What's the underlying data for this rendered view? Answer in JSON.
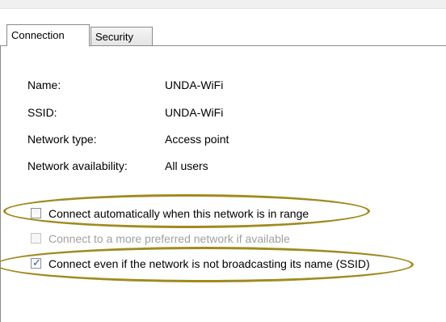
{
  "tabs": [
    {
      "label": "Connection"
    },
    {
      "label": "Security"
    }
  ],
  "info": {
    "name_label": "Name:",
    "name_value": "UNDA-WiFi",
    "ssid_label": "SSID:",
    "ssid_value": "UNDA-WiFi",
    "type_label": "Network type:",
    "type_value": "Access point",
    "availability_label": "Network availability:",
    "availability_value": "All users"
  },
  "options": [
    {
      "label": "Connect automatically when this network is in range",
      "checked": false,
      "enabled": true
    },
    {
      "label": "Connect to a more preferred network if available",
      "checked": false,
      "enabled": false
    },
    {
      "label": "Connect even if the network is not broadcasting its name (SSID)",
      "checked": true,
      "enabled": true
    }
  ],
  "colors": {
    "annotation_ellipse": "#a08a1f",
    "check_tick": "#2a5db0"
  }
}
